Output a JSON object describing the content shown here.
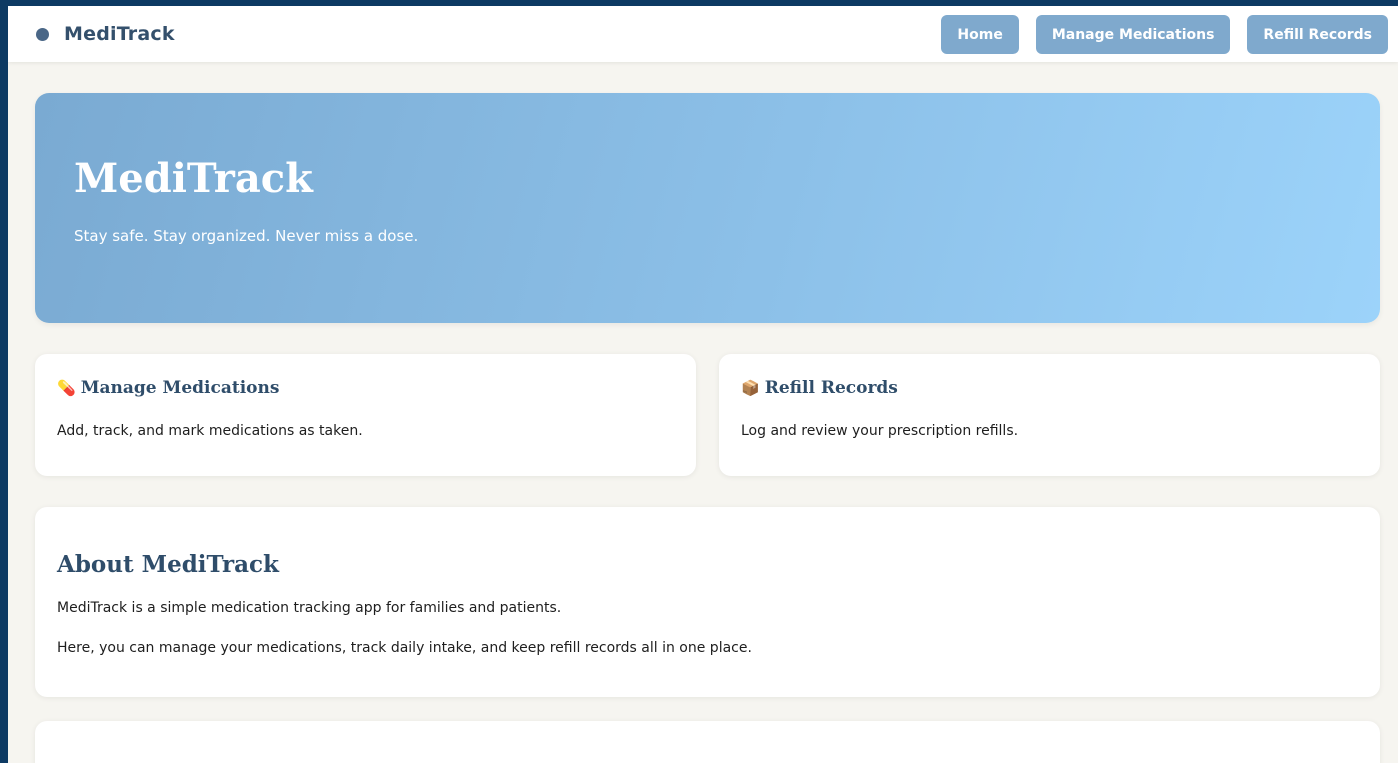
{
  "navbar": {
    "brand": "MediTrack",
    "links": [
      {
        "label": "Home"
      },
      {
        "label": "Manage Medications"
      },
      {
        "label": "Refill Records"
      }
    ]
  },
  "hero": {
    "title": "MediTrack",
    "subtitle": "Stay safe. Stay organized. Never miss a dose."
  },
  "features": [
    {
      "icon": "pill-icon",
      "icon_glyph": "💊",
      "title": "Manage Medications",
      "description": "Add, track, and mark medications as taken."
    },
    {
      "icon": "package-icon",
      "icon_glyph": "📦",
      "title": "Refill Records",
      "description": "Log and review your prescription refills."
    }
  ],
  "about": {
    "title": "About MediTrack",
    "paragraphs": [
      "MediTrack is a simple medication tracking app for families and patients.",
      "Here, you can manage your medications, track daily intake, and keep refill records all in one place."
    ]
  },
  "colors": {
    "page_border": "#0d3a63",
    "page_background": "#f6f5f0",
    "brand_text": "#34506c",
    "nav_button": "#7fa9cd",
    "hero_gradient_start": "#7aaad2",
    "hero_gradient_end": "#9cd3fa",
    "heading_text": "#2f4d6a"
  }
}
